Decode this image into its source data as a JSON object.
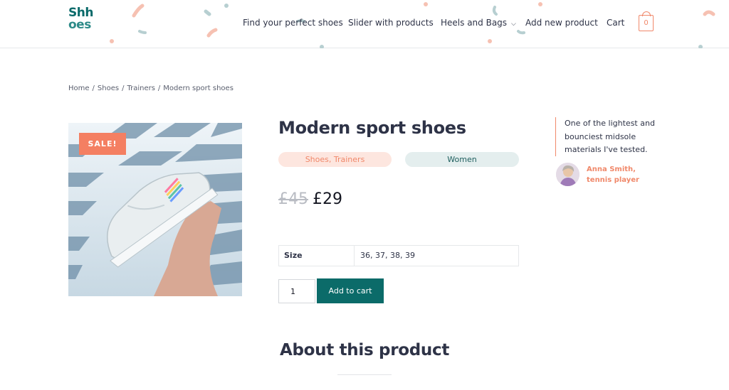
{
  "header": {
    "logo_line1": "Shh",
    "logo_line2": "oes",
    "nav": [
      {
        "label": "Find your perfect shoes"
      },
      {
        "label": "Slider with products"
      },
      {
        "label": "Heels and Bags"
      },
      {
        "label": "Add new product"
      },
      {
        "label": "Cart"
      }
    ],
    "cart_count": "0"
  },
  "breadcrumb": {
    "items": [
      "Home",
      "Shoes",
      "Trainers",
      "Modern sport shoes"
    ],
    "separator": "/"
  },
  "product": {
    "sale_badge": "SALE!",
    "title": "Modern sport shoes",
    "categories": "Shoes, Trainers",
    "gender": "Women",
    "price_old": "£45",
    "price_new": "£29",
    "attributes": [
      {
        "name": "Size",
        "value": "36, 37, 38, 39"
      }
    ],
    "quantity": "1",
    "add_to_cart_label": "Add to cart"
  },
  "testimonial": {
    "quote": "One of the lightest and bounciest midsole materials I've tested.",
    "author": "Anna Smith, tennis player"
  },
  "about": {
    "title": "About this product"
  },
  "colors": {
    "primary": "#0b6b69",
    "accent": "#f47f62",
    "text": "#2e3347"
  }
}
